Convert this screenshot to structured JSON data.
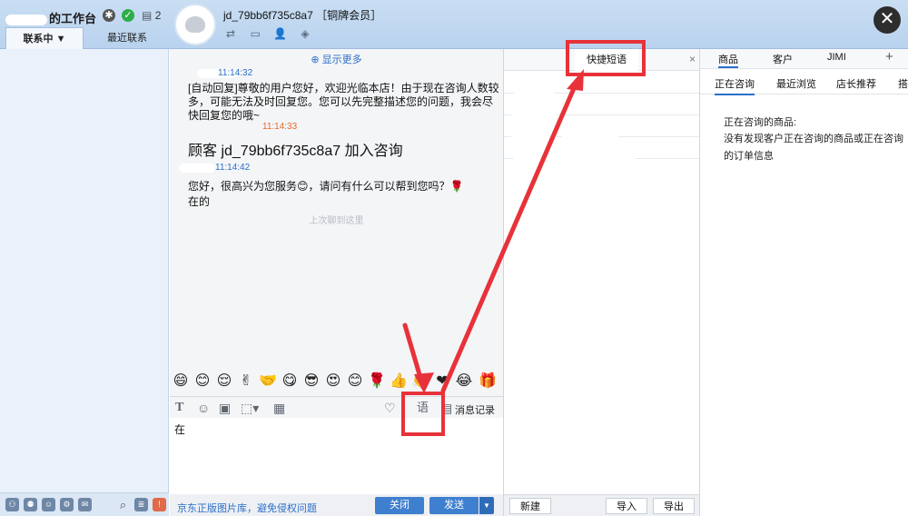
{
  "workbench": {
    "title": "的工作台",
    "message_count": "2"
  },
  "tabs": {
    "contacts": "联系中 ▼",
    "recent": "最近联系"
  },
  "user": {
    "name": "jd_79bb6f735c8a7 ［铜牌会员］"
  },
  "chat": {
    "show_more": "显示更多",
    "messages": [
      {
        "time": "11:14:32",
        "text": "[自动回复]尊敬的用户您好，欢迎光临本店！由于现在咨询人数较多，可能无法及时回复您。您可以先完整描述您的问题，我会尽快回复您的哦~"
      },
      {
        "time": "11:14:33",
        "text": "顾客 jd_79bb6f735c8a7 加入咨询"
      },
      {
        "time": "11:14:42",
        "text": "您好，很高兴为您服务😊，请问有什么可以帮到您吗？🌹"
      },
      {
        "time": "",
        "text": "在的"
      }
    ],
    "last_read": "上次聊到这里",
    "emoji": [
      "😄",
      "😊",
      "😌",
      "✌",
      "🤝",
      "😋",
      "😎",
      "😍",
      "😊",
      "🌹",
      "👍",
      "👏",
      "❤",
      "😂",
      "🎁"
    ],
    "toolbar": {
      "phrase_icon_label": "语",
      "history_label": "消息记录"
    },
    "input_value": "在",
    "footer": {
      "img_lib_link": "京东正版图片库，避免侵权问题",
      "close_label": "关闭",
      "send_label": "发送"
    }
  },
  "quick_phrase": {
    "tab_label": "快捷短语",
    "close_glyph": "×",
    "buttons": {
      "new": "新建",
      "import": "导入",
      "export": "导出"
    }
  },
  "right_panel": {
    "tabs": [
      "商品",
      "客户",
      "JIMI",
      "+"
    ],
    "subtabs": [
      "正在咨询",
      "最近浏览",
      "店长推荐",
      "搭"
    ],
    "consulting_title": "正在咨询的商品:",
    "consulting_msg": "没有发现客户正在咨询的商品或正在咨询的订单信息"
  },
  "colors": {
    "annotation": "#e8323a",
    "accent": "#2a6fc9",
    "button": "#3f7fcf"
  }
}
